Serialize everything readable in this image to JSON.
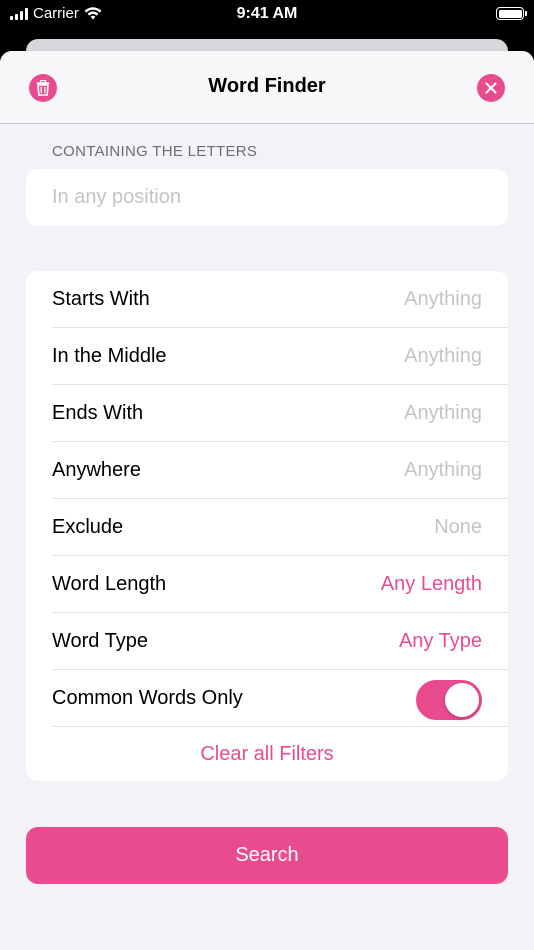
{
  "status_bar": {
    "carrier": "Carrier",
    "time": "9:41 AM"
  },
  "nav": {
    "title": "Word Finder",
    "left_icon": "trash-icon",
    "right_icon": "close-icon"
  },
  "letters_section": {
    "header": "CONTAINING THE LETTERS",
    "value": "",
    "placeholder": "In any position"
  },
  "filters": [
    {
      "label": "Starts With",
      "value": "Anything",
      "accent": false
    },
    {
      "label": "In the Middle",
      "value": "Anything",
      "accent": false
    },
    {
      "label": "Ends With",
      "value": "Anything",
      "accent": false
    },
    {
      "label": "Anywhere",
      "value": "Anything",
      "accent": false
    },
    {
      "label": "Exclude",
      "value": "None",
      "accent": false
    },
    {
      "label": "Word Length",
      "value": "Any Length",
      "accent": true
    },
    {
      "label": "Word Type",
      "value": "Any Type",
      "accent": true
    }
  ],
  "common_words": {
    "label": "Common Words Only",
    "enabled": true
  },
  "clear_label": "Clear all Filters",
  "search_label": "Search",
  "colors": {
    "accent": "#e94b8f",
    "placeholder": "#c4c4c7",
    "background": "#f2f2f7"
  }
}
